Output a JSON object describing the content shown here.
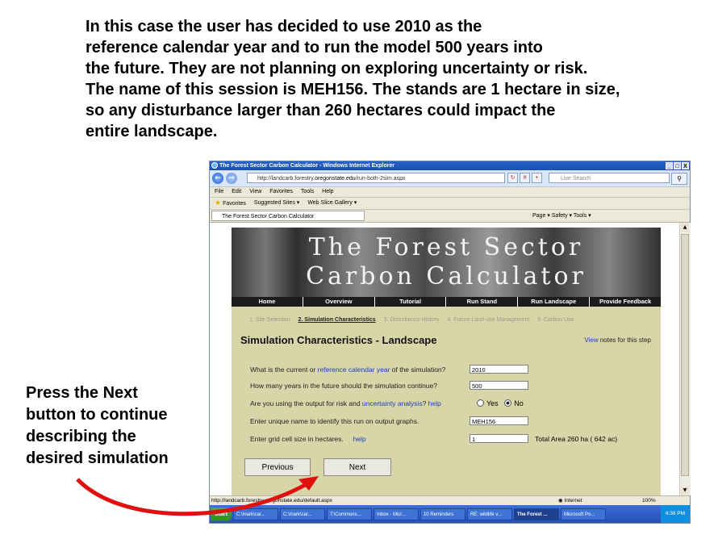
{
  "caption": {
    "lines": [
      "In this case the user has decided to use 2010 as the",
      "reference calendar year and to run the model 500 years into",
      "the future. They are not planning on exploring uncertainty or risk.",
      "The name of this session is MEH156. The stands are 1 hectare in size,",
      "so any disturbance larger than 260 hectares could impact the",
      "entire landscape."
    ]
  },
  "side_note": {
    "lines": [
      "Press the Next",
      "button to continue",
      "describing the",
      "desired simulation"
    ]
  },
  "browser": {
    "title": "The Forest Sector Carbon Calculator - Windows Internet Explorer",
    "window_buttons": [
      "_",
      "□",
      "X"
    ],
    "address_prefix": "http://landcarb.forestry.",
    "address_domain": "oregonstate.edu",
    "address_path": "/run-both-2sim.aspx",
    "live_search_placeholder": "Live Search",
    "menu": [
      "File",
      "Edit",
      "View",
      "Favorites",
      "Tools",
      "Help"
    ],
    "favorites_label": "Favorites",
    "suggested_sites": "Suggested Sites ▾",
    "web_slice": "Web Slice Gallery ▾",
    "tab_title": "The Forest Sector Carbon Calculator",
    "command_bar": "Page ▾   Safety ▾   Tools ▾",
    "status_url": "http://landcarb.forestry.oregonstate.edu/default.aspx",
    "status_zone": "Internet",
    "status_zoom": "100%",
    "taskbar": {
      "start": "Start",
      "tasks": [
        "C:\\mark\\car...",
        "C:\\mark\\car...",
        "T:\\Commons...",
        "Inbox - Micr...",
        "10 Reminders",
        "RE: wildlife v...",
        "The Forest ...",
        "Microsoft Po..."
      ],
      "active_task_index": 6,
      "clock": "4:38 PM"
    }
  },
  "site": {
    "banner_line1": "The Forest Sector",
    "banner_line2": "Carbon Calculator",
    "nav": [
      "Home",
      "Overview",
      "Tutorial",
      "Run Stand",
      "Run Landscape",
      "Provide Feedback"
    ],
    "steps": [
      "1. Site Selection",
      "2. Simulation Characteristics",
      "3. Disturbance History",
      "4. Future Land-use Management",
      "5. Carbon Use"
    ],
    "active_step_index": 1,
    "section_title": "Simulation Characteristics - Landscape",
    "view_link": "View",
    "view_suffix": " notes for this step",
    "q1_pre": "What is the current or ",
    "q1_link": "reference calendar year",
    "q1_post": " of the simulation?",
    "q1_value": "2010",
    "q2": "How many years in the future should the simulation continue?",
    "q2_value": "500",
    "q3_pre": "Are you using the output for risk and ",
    "q3_link": "uncertainty analysis",
    "q3_post": "?  ",
    "q3_help": "help",
    "radio_yes": "Yes",
    "radio_no": "No",
    "radio_selected": "No",
    "q4": "Enter unique name to identify this run on output graphs.",
    "q4_value": "MEH156",
    "q5": "Enter grid cell size in hectares.",
    "q5_help": "help",
    "q5_value": "1",
    "total_area": "Total Area  260  ha ( 642  ac)",
    "previous_button": "Previous",
    "next_button": "Next"
  },
  "colors": {
    "arrow": "#e01010",
    "site_background": "#d8d5a8",
    "link": "#1d3fbf"
  }
}
